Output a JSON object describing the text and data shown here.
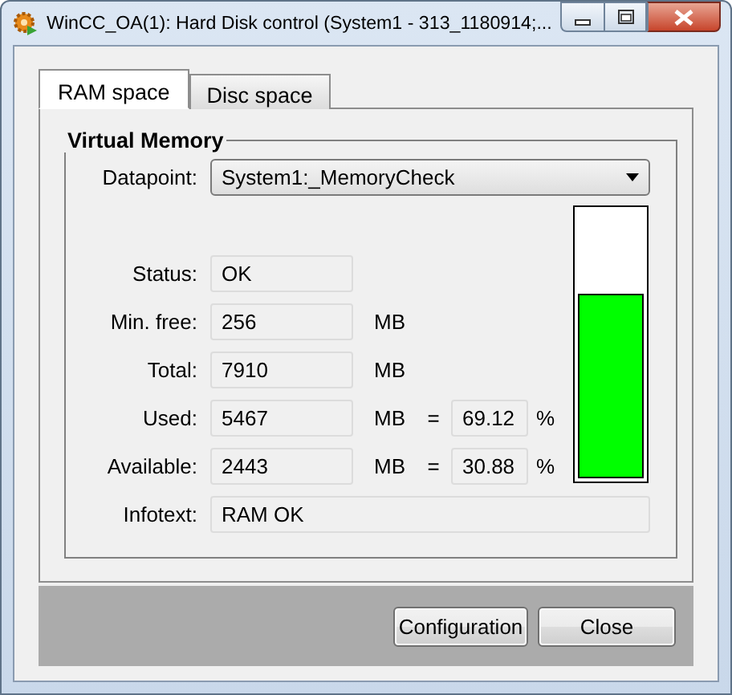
{
  "window": {
    "title": "WinCC_OA(1): Hard Disk control (System1 - 313_1180914;..."
  },
  "tabs": [
    {
      "label": "RAM space",
      "selected": true
    },
    {
      "label": "Disc space",
      "selected": false
    }
  ],
  "group": {
    "title": "Virtual Memory",
    "datapoint": {
      "label": "Datapoint:",
      "value": "System1:_MemoryCheck"
    },
    "rows": [
      {
        "label": "Status:",
        "value": "OK"
      },
      {
        "label": "Min. free:",
        "value": "256",
        "unit": "MB"
      },
      {
        "label": "Total:",
        "value": "7910",
        "unit": "MB"
      },
      {
        "label": "Used:",
        "value": "5467",
        "unit": "MB",
        "equals": "=",
        "percent": "69.12",
        "percent_unit": "%"
      },
      {
        "label": "Available:",
        "value": "2443",
        "unit": "MB",
        "equals": "=",
        "percent": "30.88",
        "percent_unit": "%"
      }
    ],
    "infotext": {
      "label": "Infotext:",
      "value": "RAM OK"
    },
    "meter": {
      "level": 0.6912
    }
  },
  "buttons": [
    {
      "label": "Configuration"
    },
    {
      "label": "Close"
    }
  ]
}
